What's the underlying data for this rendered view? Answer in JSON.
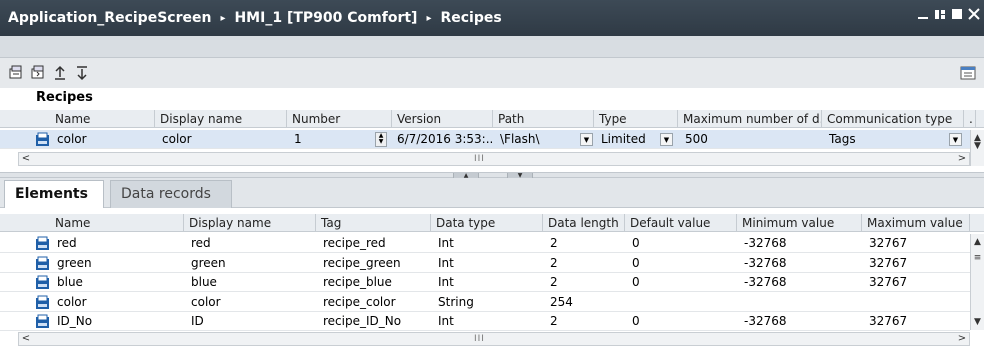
{
  "window": {
    "breadcrumb": [
      "Application_RecipeScreen",
      "HMI_1 [TP900 Comfort]",
      "Recipes"
    ],
    "separator": "▸",
    "controls": [
      "minimize",
      "restore",
      "maximize",
      "close"
    ]
  },
  "toolbar": {
    "icons": [
      "import-icon",
      "export-icon",
      "move-up-icon",
      "move-down-icon"
    ],
    "right_icon": "view-toggle-icon"
  },
  "recipes": {
    "title": "Recipes",
    "columns": [
      "Name",
      "Display name",
      "Number",
      "Version",
      "Path",
      "Type",
      "Maximum number of d..",
      "Communication type",
      "."
    ],
    "rows": [
      {
        "name": "color",
        "display_name": "color",
        "number": "1",
        "version": "6/7/2016 3:53:...",
        "path": "\\Flash\\",
        "type": "Limited",
        "max_records": "500",
        "communication": "Tags"
      }
    ]
  },
  "tabs": [
    {
      "label": "Elements",
      "active": true
    },
    {
      "label": "Data records",
      "active": false
    }
  ],
  "elements": {
    "columns": [
      "Name",
      "Display name",
      "Tag",
      "Data type",
      "Data length",
      "Default value",
      "Minimum value",
      "Maximum value"
    ],
    "rows": [
      {
        "name": "red",
        "display_name": "red",
        "tag": "recipe_red",
        "data_type": "Int",
        "length": "2",
        "default": "0",
        "min": "-32768",
        "max": "32767"
      },
      {
        "name": "green",
        "display_name": "green",
        "tag": "recipe_green",
        "data_type": "Int",
        "length": "2",
        "default": "0",
        "min": "-32768",
        "max": "32767"
      },
      {
        "name": "blue",
        "display_name": "blue",
        "tag": "recipe_blue",
        "data_type": "Int",
        "length": "2",
        "default": "0",
        "min": "-32768",
        "max": "32767"
      },
      {
        "name": "color",
        "display_name": "color",
        "tag": "recipe_color",
        "data_type": "String",
        "length": "254",
        "default": "",
        "min": "",
        "max": ""
      },
      {
        "name": "ID_No",
        "display_name": "ID",
        "tag": "recipe_ID_No",
        "data_type": "Int",
        "length": "2",
        "default": "0",
        "min": "-32768",
        "max": "32767"
      }
    ]
  },
  "scroll": {
    "left_arrow": "<",
    "right_arrow": ">",
    "grip": "III"
  },
  "colors": {
    "title_bg": "#343f4a",
    "header_bg": "#e9edf1",
    "icon_blue": "#1f5fa8"
  }
}
